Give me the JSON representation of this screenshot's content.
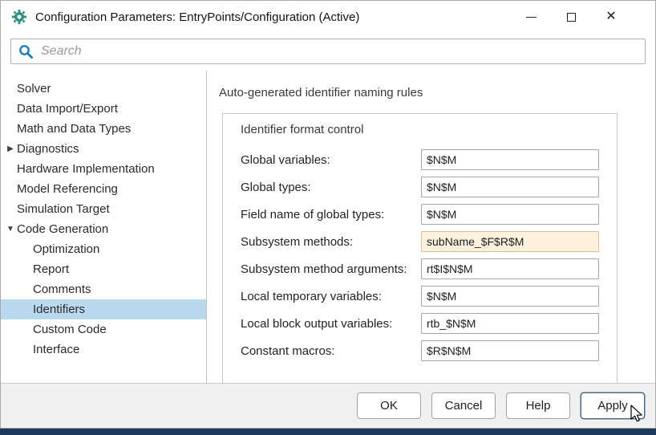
{
  "window": {
    "title": "Configuration Parameters: EntryPoints/Configuration (Active)",
    "icons": {
      "app": "simulink-gear-icon",
      "minimize": "minimize-icon",
      "maximize": "maximize-icon",
      "close": "close-icon"
    },
    "close_glyph": "✕"
  },
  "search": {
    "placeholder": "Search",
    "icon": "search-icon"
  },
  "sidebar": {
    "items": [
      {
        "label": "Solver",
        "level": 0,
        "arrow": ""
      },
      {
        "label": "Data Import/Export",
        "level": 0,
        "arrow": ""
      },
      {
        "label": "Math and Data Types",
        "level": 0,
        "arrow": ""
      },
      {
        "label": "Diagnostics",
        "level": 0,
        "arrow": "▶"
      },
      {
        "label": "Hardware Implementation",
        "level": 0,
        "arrow": ""
      },
      {
        "label": "Model Referencing",
        "level": 0,
        "arrow": ""
      },
      {
        "label": "Simulation Target",
        "level": 0,
        "arrow": ""
      },
      {
        "label": "Code Generation",
        "level": 0,
        "arrow": "▼"
      },
      {
        "label": "Optimization",
        "level": 1,
        "arrow": ""
      },
      {
        "label": "Report",
        "level": 1,
        "arrow": ""
      },
      {
        "label": "Comments",
        "level": 1,
        "arrow": ""
      },
      {
        "label": "Identifiers",
        "level": 1,
        "arrow": "",
        "selected": true
      },
      {
        "label": "Custom Code",
        "level": 1,
        "arrow": ""
      },
      {
        "label": "Interface",
        "level": 1,
        "arrow": ""
      }
    ]
  },
  "main": {
    "heading": "Auto-generated identifier naming rules",
    "group": {
      "title": "Identifier format control",
      "fields": [
        {
          "label": "Global variables:",
          "value": "$N$M",
          "highlight": false
        },
        {
          "label": "Global types:",
          "value": "$N$M",
          "highlight": false
        },
        {
          "label": "Field name of global types:",
          "value": "$N$M",
          "highlight": false
        },
        {
          "label": "Subsystem methods:",
          "value": "subName_$F$R$M",
          "highlight": true
        },
        {
          "label": "Subsystem method arguments:",
          "value": "rt$I$N$M",
          "highlight": false
        },
        {
          "label": "Local temporary variables:",
          "value": "$N$M",
          "highlight": false
        },
        {
          "label": "Local block output variables:",
          "value": "rtb_$N$M",
          "highlight": false
        },
        {
          "label": "Constant macros:",
          "value": "$R$N$M",
          "highlight": false
        }
      ]
    }
  },
  "footer": {
    "buttons": [
      {
        "label": "OK"
      },
      {
        "label": "Cancel"
      },
      {
        "label": "Help"
      },
      {
        "label": "Apply",
        "focused": true
      }
    ]
  },
  "colors": {
    "selection_blue": "#b9d9ef",
    "highlight_field_bg": "#fdf1dd",
    "search_icon_blue": "#1a7db6",
    "app_icon_teal": "#2f8f7f",
    "taskbar_navy": "#1c3a5e",
    "footer_gray": "#f0f0f0"
  }
}
